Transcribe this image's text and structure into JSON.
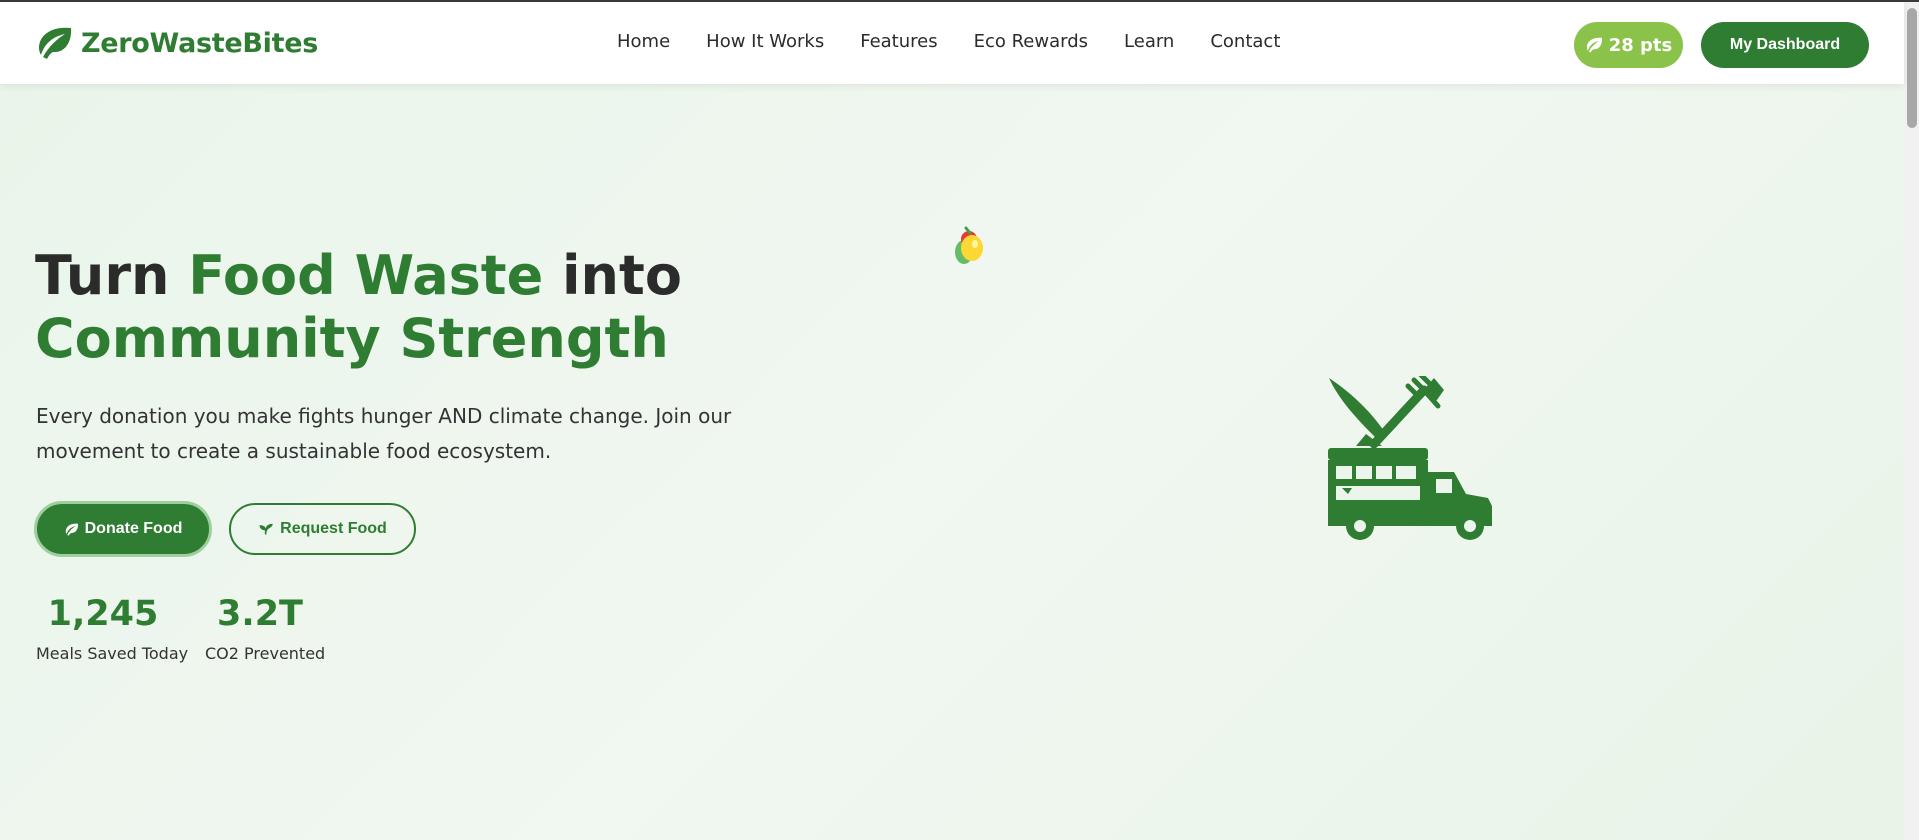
{
  "brand": {
    "name": "ZeroWasteBites",
    "icon": "leaf-icon"
  },
  "nav": {
    "links": [
      "Home",
      "How It Works",
      "Features",
      "Eco Rewards",
      "Learn",
      "Contact"
    ]
  },
  "header": {
    "points_label": "28 pts",
    "dashboard_label": "My Dashboard"
  },
  "hero": {
    "headline_part1": "Turn ",
    "headline_highlight1": "Food Waste",
    "headline_part2": " into",
    "headline_highlight2": "Community Strength",
    "subtext": "Every donation you make fights hunger AND climate change. Join our movement to create a sustainable food ecosystem.",
    "donate_label": "Donate Food",
    "request_label": "Request Food",
    "stats": [
      {
        "value": "1,245",
        "label": "Meals Saved Today"
      },
      {
        "value": "3.2T",
        "label": "CO2 Prevented"
      }
    ]
  },
  "colors": {
    "primary": "#2e7d32",
    "accent": "#8bc34a",
    "background": "#e9f5ea",
    "text": "#2b2b2b"
  }
}
